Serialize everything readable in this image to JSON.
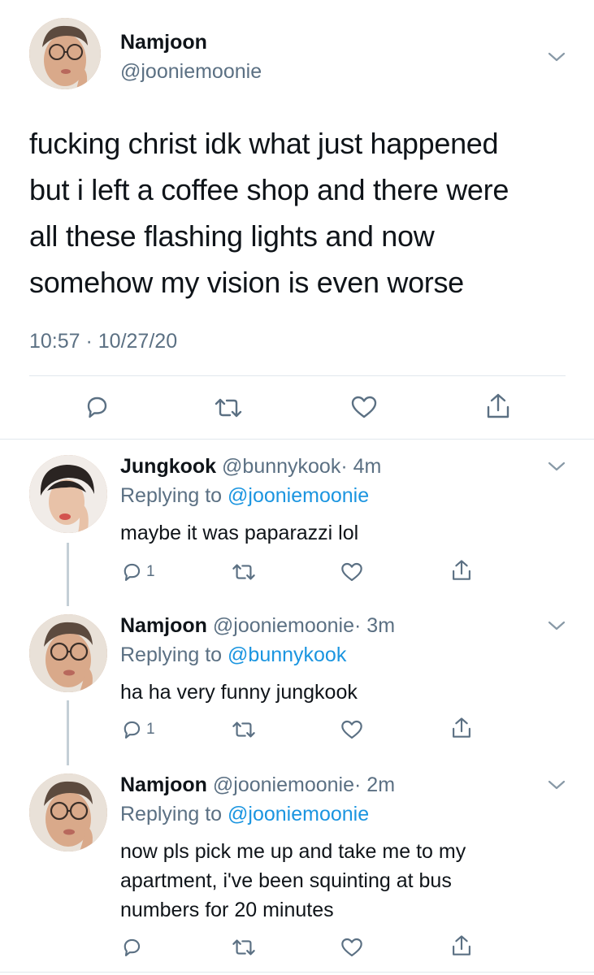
{
  "main_tweet": {
    "author_name": "Namjoon",
    "author_handle": "@jooniemoonie",
    "text_lines": [
      "fucking christ idk what just happened",
      "but i left a coffee shop and there were",
      "all these flashing lights and now",
      "somehow my vision is even worse"
    ],
    "timestamp": "10:57 · 10/27/20"
  },
  "replies": [
    {
      "author_name": "Jungkook",
      "author_handle": "@bunnykook",
      "time": "· 4m",
      "replying_prefix": "Replying to",
      "replying_to": "@jooniemoonie",
      "text_lines": [
        "maybe it was paparazzi lol"
      ],
      "reply_count": "1"
    },
    {
      "author_name": "Namjoon",
      "author_handle": "@jooniemoonie",
      "time": "· 3m",
      "replying_prefix": "Replying to",
      "replying_to": "@bunnykook",
      "text_lines": [
        "ha ha very funny jungkook"
      ],
      "reply_count": "1"
    },
    {
      "author_name": "Namjoon",
      "author_handle": "@jooniemoonie",
      "time": "· 2m",
      "replying_prefix": "Replying to",
      "replying_to": "@jooniemoonie",
      "text_lines": [
        "now pls pick me up and take me to my",
        "apartment, i've been squinting at bus",
        "numbers for 20 minutes"
      ],
      "reply_count": ""
    }
  ],
  "icons": {
    "reply": "reply-icon",
    "retweet": "retweet-icon",
    "like": "like-icon",
    "share": "share-icon",
    "more": "chevron-down-icon"
  },
  "colors": {
    "text": "#0f1419",
    "secondary": "#5b7083",
    "link": "#1b95e0",
    "divider": "#e1e8ed"
  }
}
